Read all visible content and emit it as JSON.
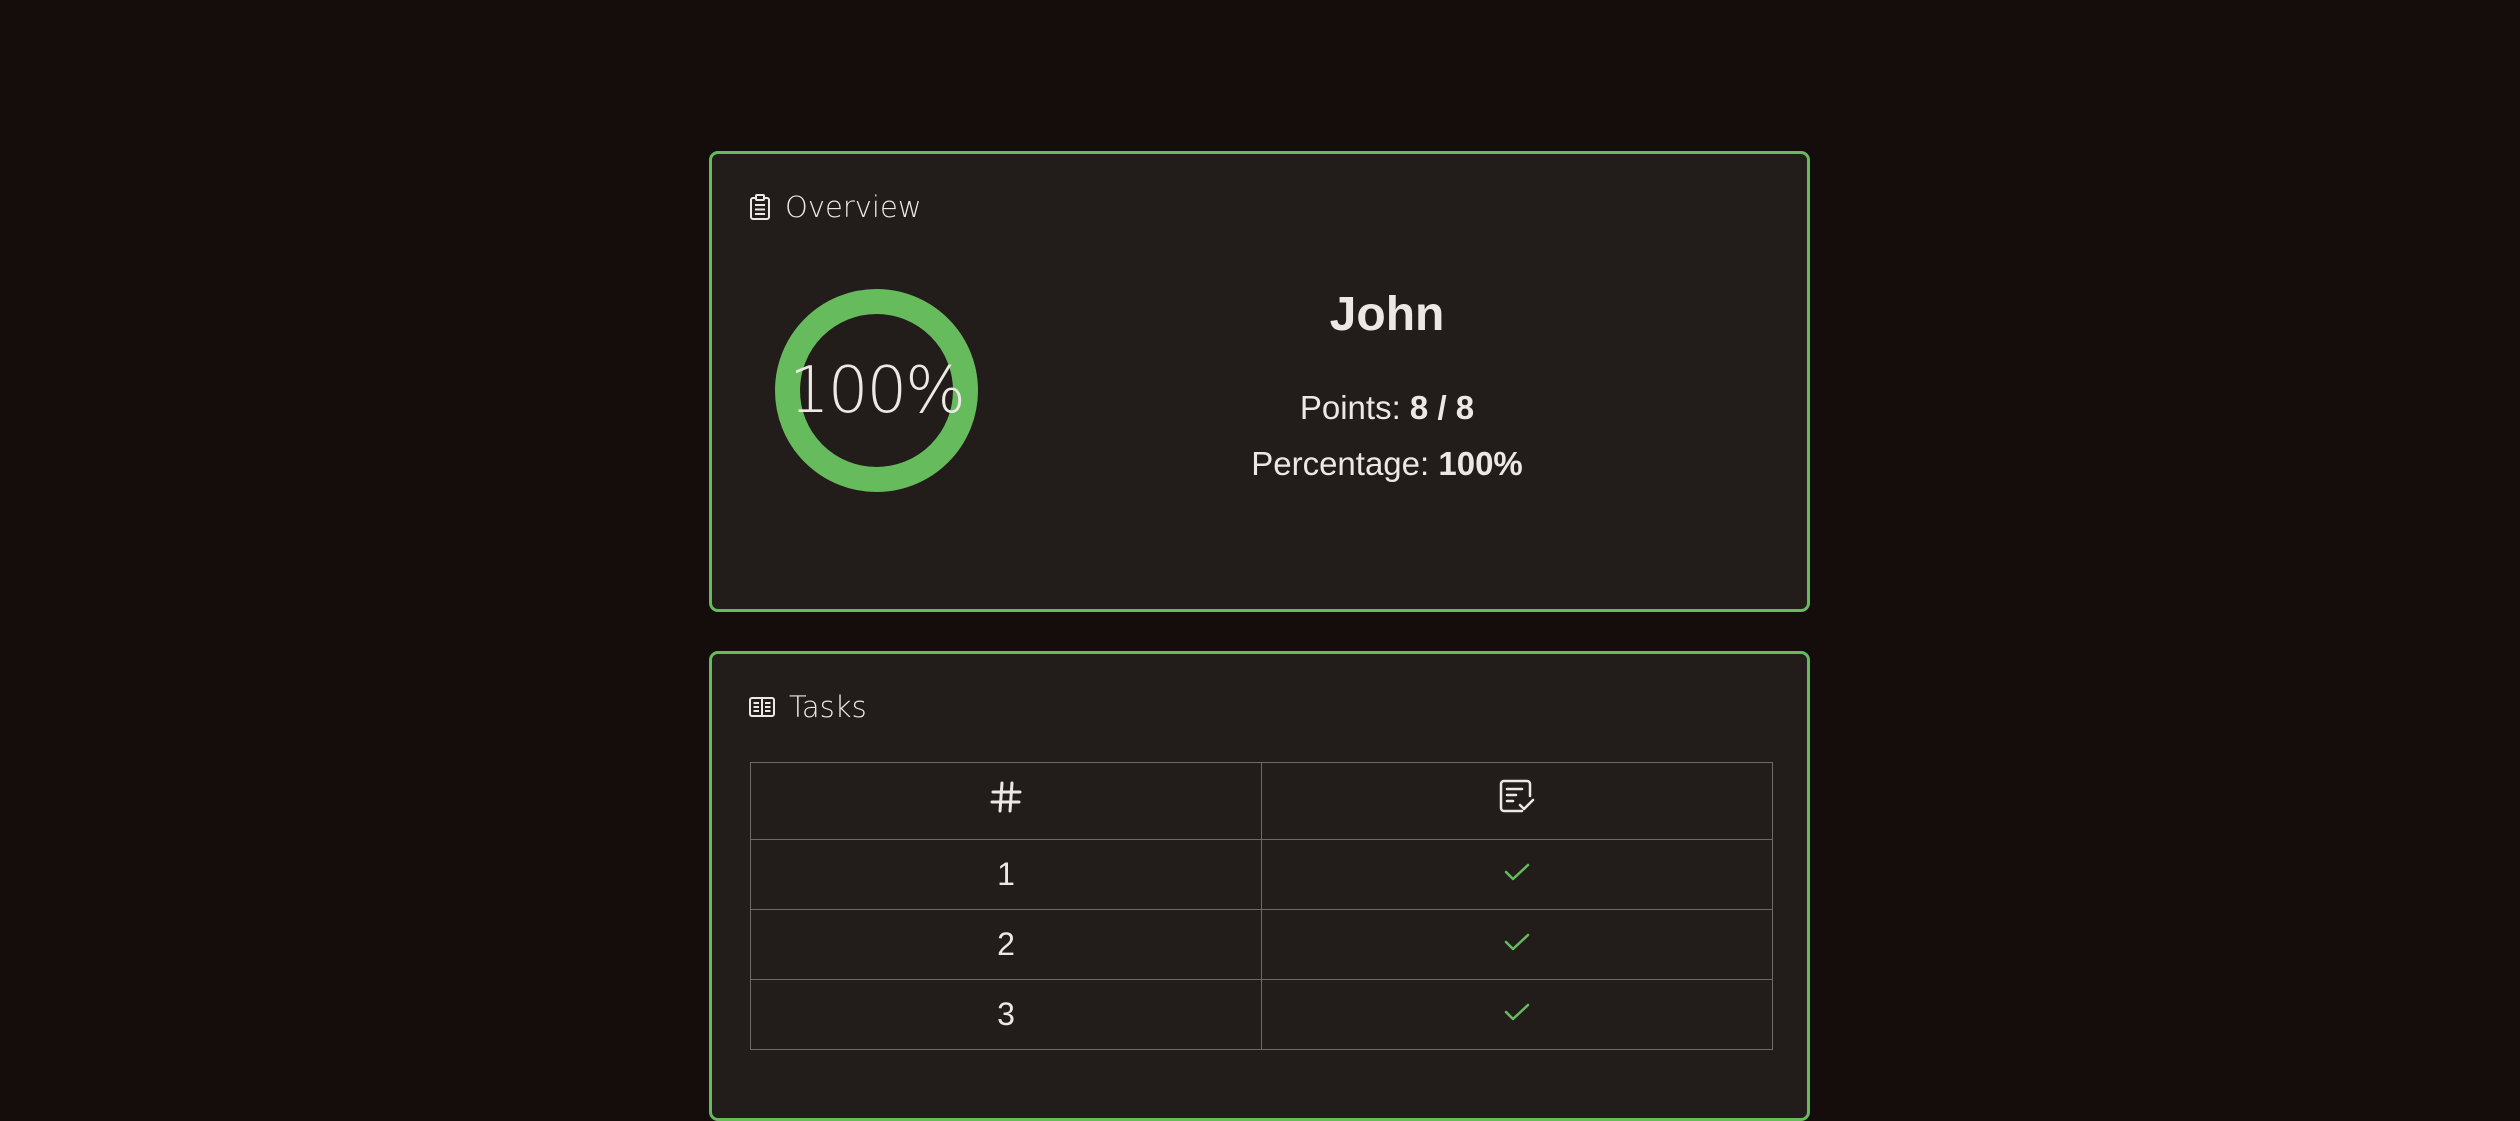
{
  "overview": {
    "title": "Overview",
    "icon": "clipboard-icon",
    "progress_percent": 100,
    "progress_label": "100%",
    "student_name": "John",
    "points_label": "Points:",
    "points_value": "8 / 8",
    "percentage_label": "Percentage:",
    "percentage_value": "100%"
  },
  "tasks": {
    "title": "Tasks",
    "icon": "task-list-icon",
    "columns": [
      {
        "icon": "hash-icon"
      },
      {
        "icon": "task-checked-icon"
      }
    ],
    "rows": [
      {
        "number": "1",
        "status": "check-icon"
      },
      {
        "number": "2",
        "status": "check-icon"
      },
      {
        "number": "3",
        "status": "check-icon"
      }
    ]
  },
  "colors": {
    "background": "#140d0b",
    "card": "#221d1b",
    "accent": "#66bb5c",
    "text": "#ece8e4"
  }
}
